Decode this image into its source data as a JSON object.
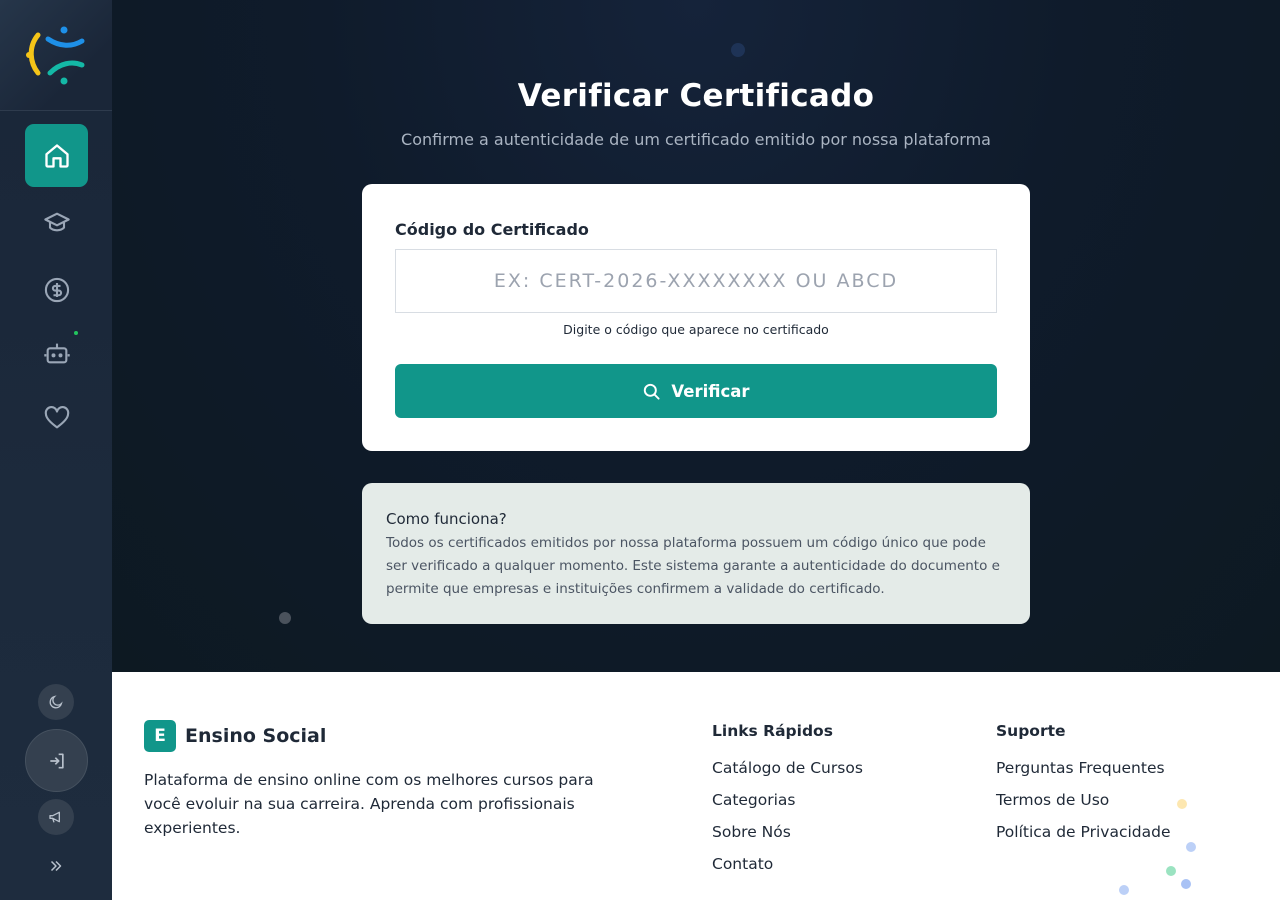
{
  "sidebar": {
    "nav": [
      {
        "icon": "home-icon",
        "active": true
      },
      {
        "icon": "graduation-cap-icon",
        "active": false
      },
      {
        "icon": "dollar-icon",
        "active": false
      },
      {
        "icon": "robot-icon",
        "active": false
      },
      {
        "icon": "heart-icon",
        "active": false
      }
    ],
    "bottom": [
      "moon-icon",
      "logout-icon",
      "megaphone-icon",
      "chevrons-right-icon"
    ]
  },
  "hero": {
    "title": "Verificar Certificado",
    "subtitle": "Confirme a autenticidade de um certificado emitido por nossa plataforma"
  },
  "form": {
    "label": "Código do Certificado",
    "value": "",
    "placeholder": "Ex: CERT-2026-XXXXXXXX ou ABCD",
    "hint": "Digite o código que aparece no certificado",
    "button": "Verificar"
  },
  "info": {
    "title": "Como funciona?",
    "text": "Todos os certificados emitidos por nossa plataforma possuem um código único que pode ser verificado a qualquer momento. Este sistema garante a autenticidade do documento e permite que empresas e instituições confirmem a validade do certificado."
  },
  "footer": {
    "brand_letter": "E",
    "brand_name": "Ensino Social",
    "description": "Plataforma de ensino online com os melhores cursos para você evoluir na sua carreira. Aprenda com profissionais experientes.",
    "links_title": "Links Rápidos",
    "links": [
      "Catálogo de Cursos",
      "Categorias",
      "Sobre Nós",
      "Contato"
    ],
    "support_title": "Suporte",
    "support": [
      "Perguntas Frequentes",
      "Termos de Uso",
      "Política de Privacidade"
    ]
  },
  "colors": {
    "accent": "#11968a",
    "sidebar": "#1c2a3c",
    "hero_bg": "#0f1b2b"
  }
}
